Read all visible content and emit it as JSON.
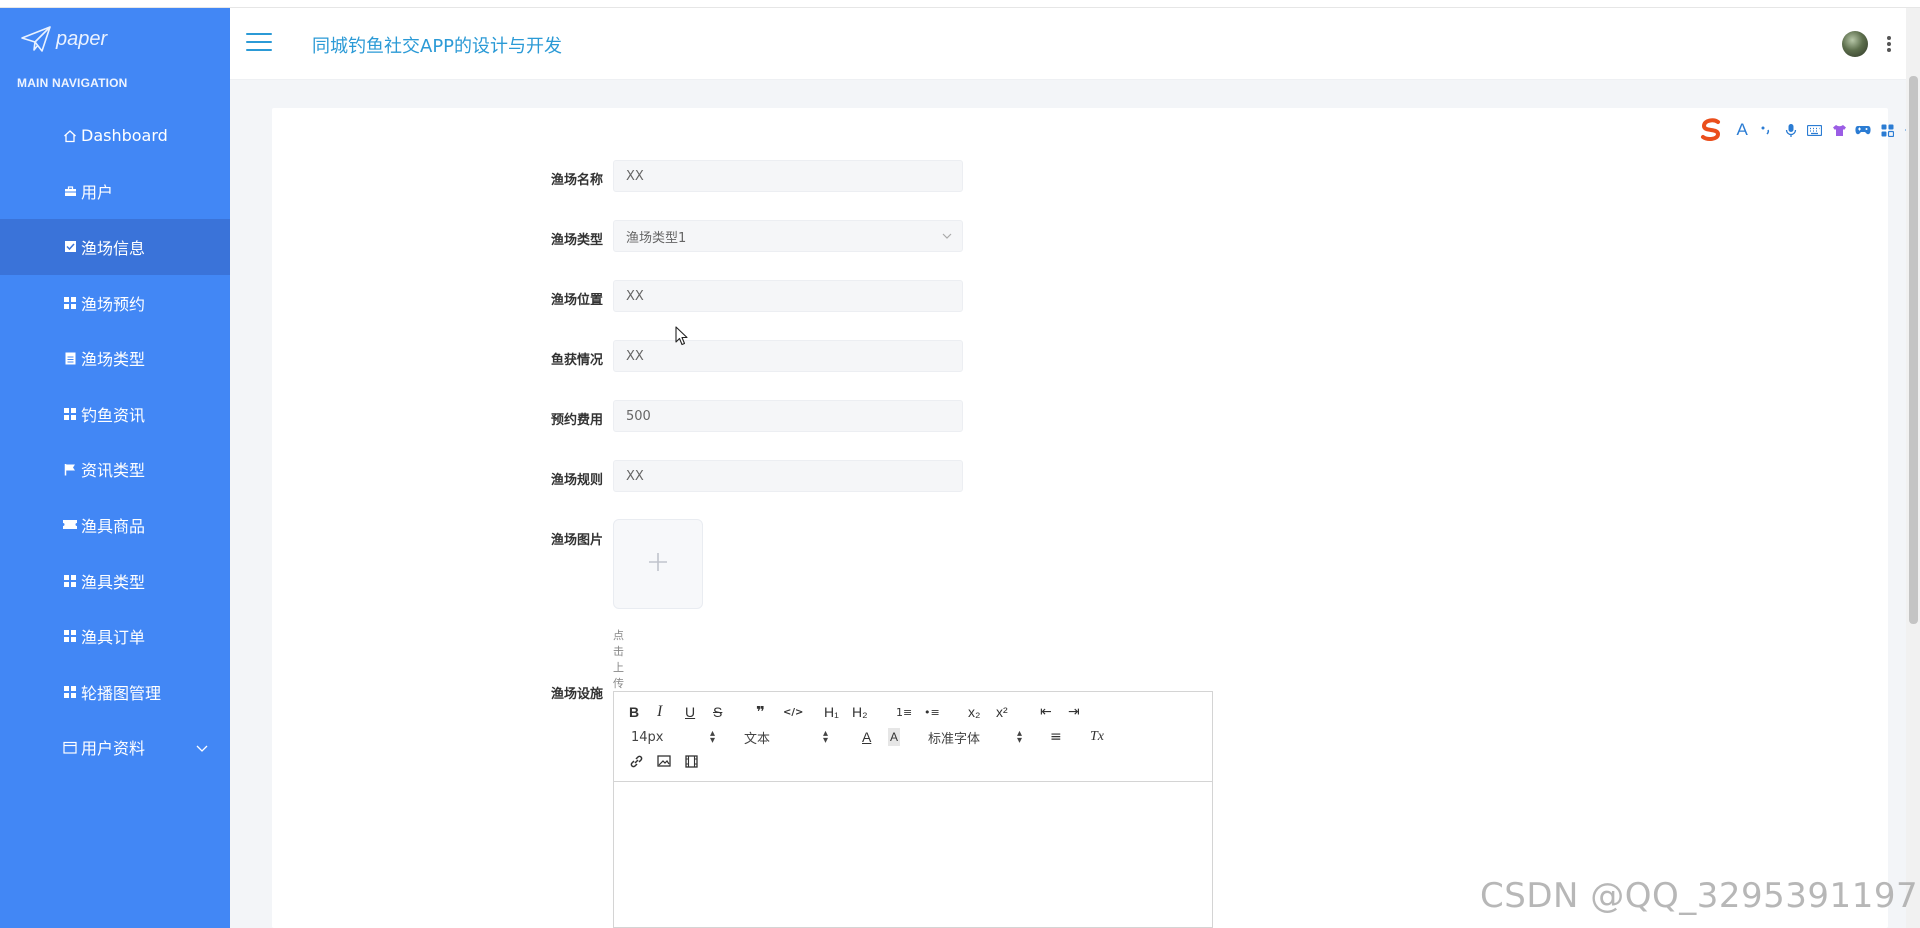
{
  "brand": {
    "logo_text": "paper"
  },
  "sidebar": {
    "heading": "MAIN NAVIGATION",
    "items": [
      {
        "label": "Dashboard",
        "icon": "home-icon"
      },
      {
        "label": "用户",
        "icon": "briefcase-icon"
      },
      {
        "label": "渔场信息",
        "icon": "checkbox-icon",
        "active": true
      },
      {
        "label": "渔场预约",
        "icon": "grid-icon"
      },
      {
        "label": "渔场类型",
        "icon": "document-icon"
      },
      {
        "label": "钓鱼资讯",
        "icon": "grid-icon"
      },
      {
        "label": "资讯类型",
        "icon": "flag-icon"
      },
      {
        "label": "渔具商品",
        "icon": "ticket-icon"
      },
      {
        "label": "渔具类型",
        "icon": "grid-icon"
      },
      {
        "label": "渔具订单",
        "icon": "grid-icon"
      },
      {
        "label": "轮播图管理",
        "icon": "grid-icon"
      },
      {
        "label": "用户资料",
        "icon": "calendar-icon",
        "expandable": true
      }
    ]
  },
  "header": {
    "title": "同城钓鱼社交APP的设计与开发"
  },
  "form": {
    "name": {
      "label": "渔场名称",
      "value": "XX"
    },
    "type": {
      "label": "渔场类型",
      "value": "渔场类型1"
    },
    "location": {
      "label": "渔场位置",
      "value": "XX"
    },
    "catch": {
      "label": "鱼获情况",
      "value": "XX"
    },
    "fee": {
      "label": "预约费用",
      "value": "500"
    },
    "rules": {
      "label": "渔场规则",
      "value": "XX"
    },
    "image": {
      "label": "渔场图片",
      "hint": "点击上传渔场图片"
    },
    "facilities": {
      "label": "渔场设施"
    }
  },
  "editor": {
    "buttons": {
      "bold": "B",
      "italic": "I",
      "underline": "U",
      "strike": "S",
      "quote": "❞",
      "code": "</>",
      "h1": "H₁",
      "h2": "H₂",
      "ordered_list": "1≡",
      "bullet_list": "•≡",
      "subscript": "x₂",
      "superscript": "x²",
      "outdent": "⇤",
      "indent": "⇥",
      "font_color": "A",
      "background": "A",
      "align": "≡",
      "clean": "Tx"
    },
    "size_value": "14px",
    "header_value": "文本",
    "font_value": "标准字体"
  },
  "ime_toolbar": {
    "pinyin_label": "A"
  },
  "watermark": "CSDN @QQ_3295391197",
  "colors": {
    "sidebar": "#4287f5",
    "sidebar_active": "#3a73d9",
    "title": "#2b9ad6"
  }
}
